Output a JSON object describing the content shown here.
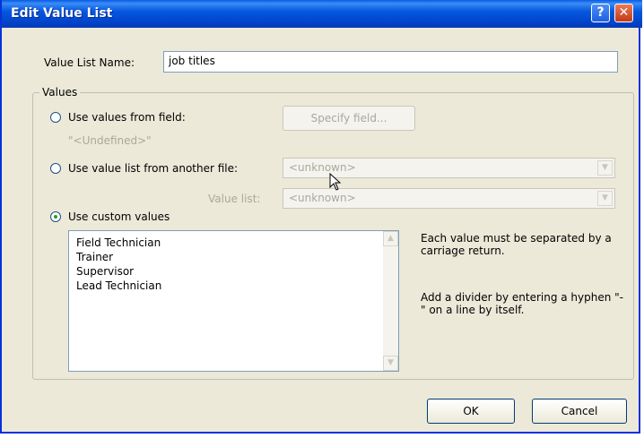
{
  "window": {
    "title": "Edit Value List",
    "help_glyph": "?",
    "close_glyph": "✕"
  },
  "name_field": {
    "label": "Value List Name:",
    "value": "job titles"
  },
  "values_group": {
    "title": "Values",
    "option_field": {
      "label": "Use values from field:",
      "button": "Specify field...",
      "undefined_text": "\"<Undefined>\""
    },
    "option_file": {
      "label": "Use value list from another file:",
      "file_combo": "<unknown>",
      "value_list_label": "Value list:",
      "value_list_combo": "<unknown>"
    },
    "option_custom": {
      "label": "Use custom values",
      "selected": true
    },
    "custom_values": [
      "Field Technician",
      "Trainer",
      "Supervisor",
      "Lead Technician"
    ],
    "help": {
      "line1": "Each value must be separated by a carriage return.",
      "line2": "Add a divider by entering a hyphen \"-\" on a line by itself."
    }
  },
  "buttons": {
    "ok": "OK",
    "cancel": "Cancel"
  },
  "colors": {
    "title_bar": "#0758e0",
    "dialog_bg": "#ece9d8",
    "close_button": "#c43a16"
  }
}
